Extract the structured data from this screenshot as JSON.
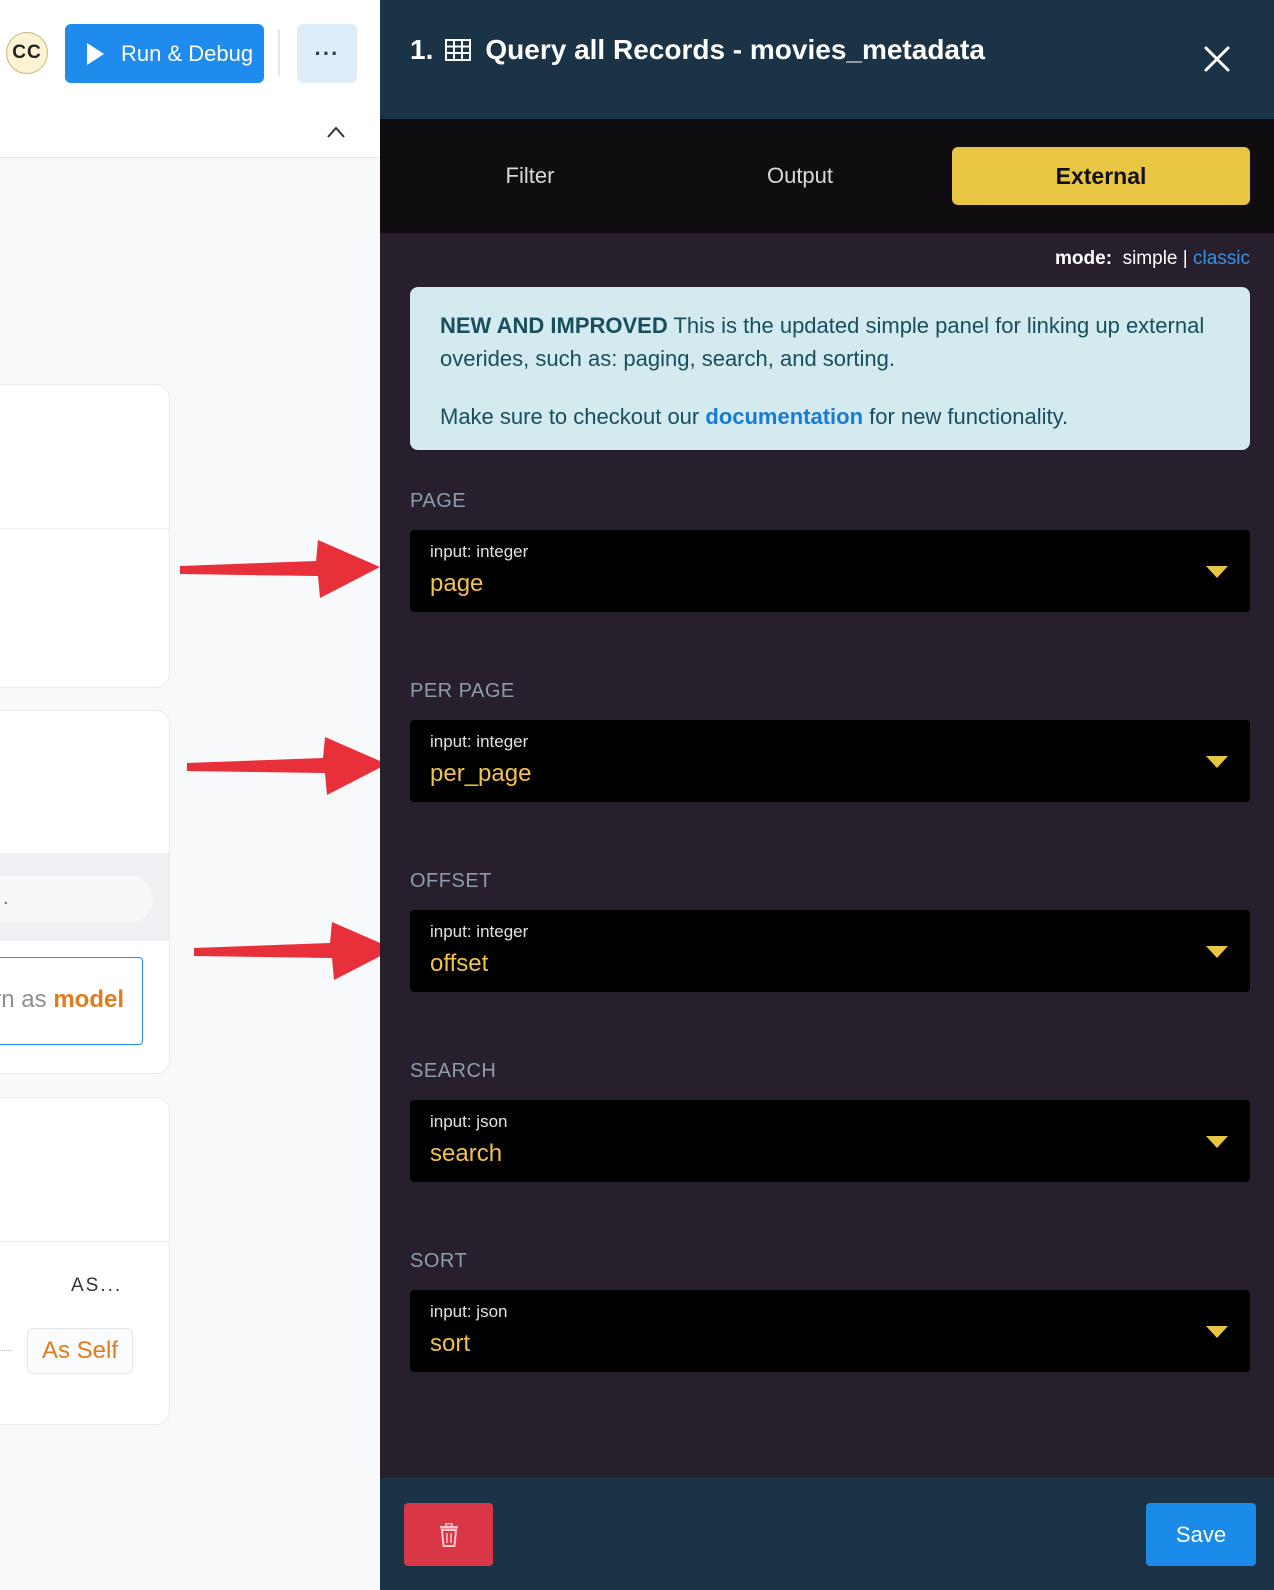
{
  "header": {
    "avatar_initials": "CC",
    "run_debug_label": "Run & Debug",
    "more_label": "···"
  },
  "background": {
    "model_prefix": "rn as",
    "model_word": "model",
    "as_label": "AS...",
    "as_self": "As Self",
    "pill_text": "."
  },
  "panel": {
    "title_number": "1.",
    "title": "Query all Records - movies_metadata",
    "tabs": [
      "Filter",
      "Output",
      "External"
    ],
    "active_tab": "External",
    "mode": {
      "label": "mode:",
      "simple": "simple",
      "separator": "|",
      "classic": "classic"
    },
    "info": {
      "heading": "NEW AND IMPROVED",
      "line1": "This is the updated simple panel for linking up external overides, such as: paging, search, and sorting.",
      "line2_pre": "Make sure to checkout our",
      "link": "documentation",
      "line2_post": "for new functionality."
    },
    "fields": [
      {
        "label": "PAGE",
        "type": "input: integer",
        "value": "page"
      },
      {
        "label": "PER PAGE",
        "type": "input: integer",
        "value": "per_page"
      },
      {
        "label": "OFFSET",
        "type": "input: integer",
        "value": "offset"
      },
      {
        "label": "SEARCH",
        "type": "input: json",
        "value": "search"
      },
      {
        "label": "SORT",
        "type": "input: json",
        "value": "sort"
      }
    ],
    "save_label": "Save"
  },
  "colors": {
    "accent_blue": "#1f8bec",
    "tab_active": "#e8c543",
    "value_text": "#f0c24a",
    "delete": "#d93746",
    "arrow": "#e8303a"
  },
  "icons": [
    "play-icon",
    "more-icon",
    "chevron-up-icon",
    "table-icon",
    "close-icon",
    "caret-down-icon",
    "trash-icon",
    "arrow-icon"
  ]
}
